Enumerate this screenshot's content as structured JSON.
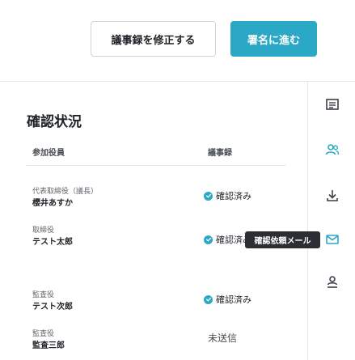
{
  "header": {
    "edit_button": "議事録を修正する",
    "sign_button": "署名に進む"
  },
  "section": {
    "title": "確認状況"
  },
  "table": {
    "headers": {
      "member": "参加役員",
      "minutes": "議事録"
    },
    "rows": [
      {
        "role": "代表取締役（議長）",
        "name": "櫻井あすか",
        "status": "確認済み",
        "confirmed": true
      },
      {
        "role": "取締役",
        "name": "テスト太郎",
        "status": "確認済み",
        "confirmed": true
      },
      {
        "role": "監査役",
        "name": "テスト次郎",
        "status": "確認済み",
        "confirmed": true
      },
      {
        "role": "監査役",
        "name": "監査三郎",
        "status": "未送信",
        "confirmed": false
      }
    ]
  },
  "tooltip": {
    "text": "確認依頼メール"
  },
  "rail": {
    "icons": [
      "notes-icon",
      "people-icon",
      "download-icon",
      "mail-icon",
      "user-stamp-icon"
    ]
  },
  "colors": {
    "accent": "#2aa8c5",
    "tooltip_bg": "#2b2f33"
  }
}
